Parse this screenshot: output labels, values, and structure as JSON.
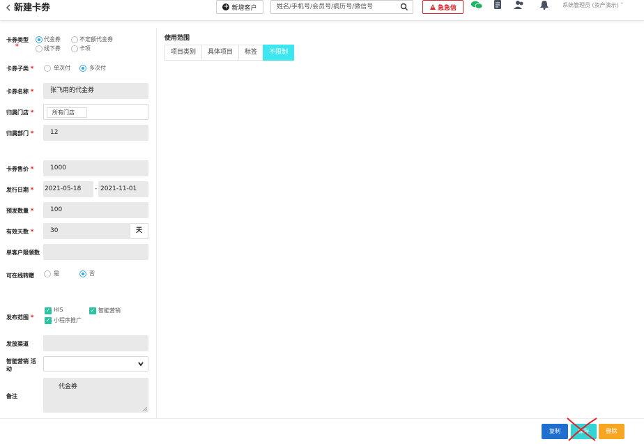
{
  "header": {
    "back_icon": "chevron-left-icon",
    "title": "新建卡券",
    "new_customer_label": "新增客户",
    "search_placeholder": "姓名/手机号/会员号/病历号/微信号",
    "urgent_label": "急急信",
    "user_label": "系统管理员 (资产演示)"
  },
  "form": {
    "coupon_type": {
      "label": "卡券类型",
      "options": [
        "代金券",
        "不定额代金券",
        "线下券",
        "卡项"
      ],
      "selected": "代金券"
    },
    "coupon_subtype": {
      "label": "卡券子类",
      "options": [
        "单次付",
        "多次付"
      ],
      "selected": "多次付"
    },
    "coupon_name": {
      "label": "卡券名称",
      "value": "张飞用的代金券"
    },
    "store": {
      "label": "归属门店",
      "value": "所有门店"
    },
    "department": {
      "label": "归属部门",
      "value": "12"
    },
    "price": {
      "label": "卡券售价",
      "value": "1000"
    },
    "issue_date": {
      "label": "发行日期",
      "start": "2021-05-18",
      "separator": "-",
      "end": "2021-11-01"
    },
    "presale_qty": {
      "label": "预发数量",
      "value": "100"
    },
    "valid_days": {
      "label": "有效天数",
      "value": "30",
      "unit": "天"
    },
    "per_customer_limit": {
      "label": "单客户限领数",
      "value": ""
    },
    "online_transfer": {
      "label": "可在线转赠",
      "options": [
        "是",
        "否"
      ],
      "selected": "否"
    },
    "publish_scope": {
      "label": "发布范围",
      "options": [
        "HIS",
        "智能营销",
        "小程序推广"
      ]
    },
    "channel": {
      "label": "发放渠道",
      "value": ""
    },
    "marketing_activity": {
      "label_line1": "智能营销 活",
      "label_line2": "动",
      "value": ""
    },
    "remark": {
      "label": "备注",
      "value": "代金券"
    }
  },
  "scope": {
    "title": "使用范围",
    "tabs": [
      "项目类别",
      "具体项目",
      "标签",
      "不限制"
    ],
    "active_tab": "不限制"
  },
  "footer": {
    "copy_label": "复制",
    "save_label": "保存",
    "delete_label": "删除"
  },
  "colors": {
    "accent_cyan": "#3ee6f0",
    "radio_blue": "#36a9e1",
    "check_green": "#2bc4a0",
    "danger_red": "#d9262c",
    "copy_blue": "#1f6fd1",
    "delete_orange": "#f6a623"
  }
}
